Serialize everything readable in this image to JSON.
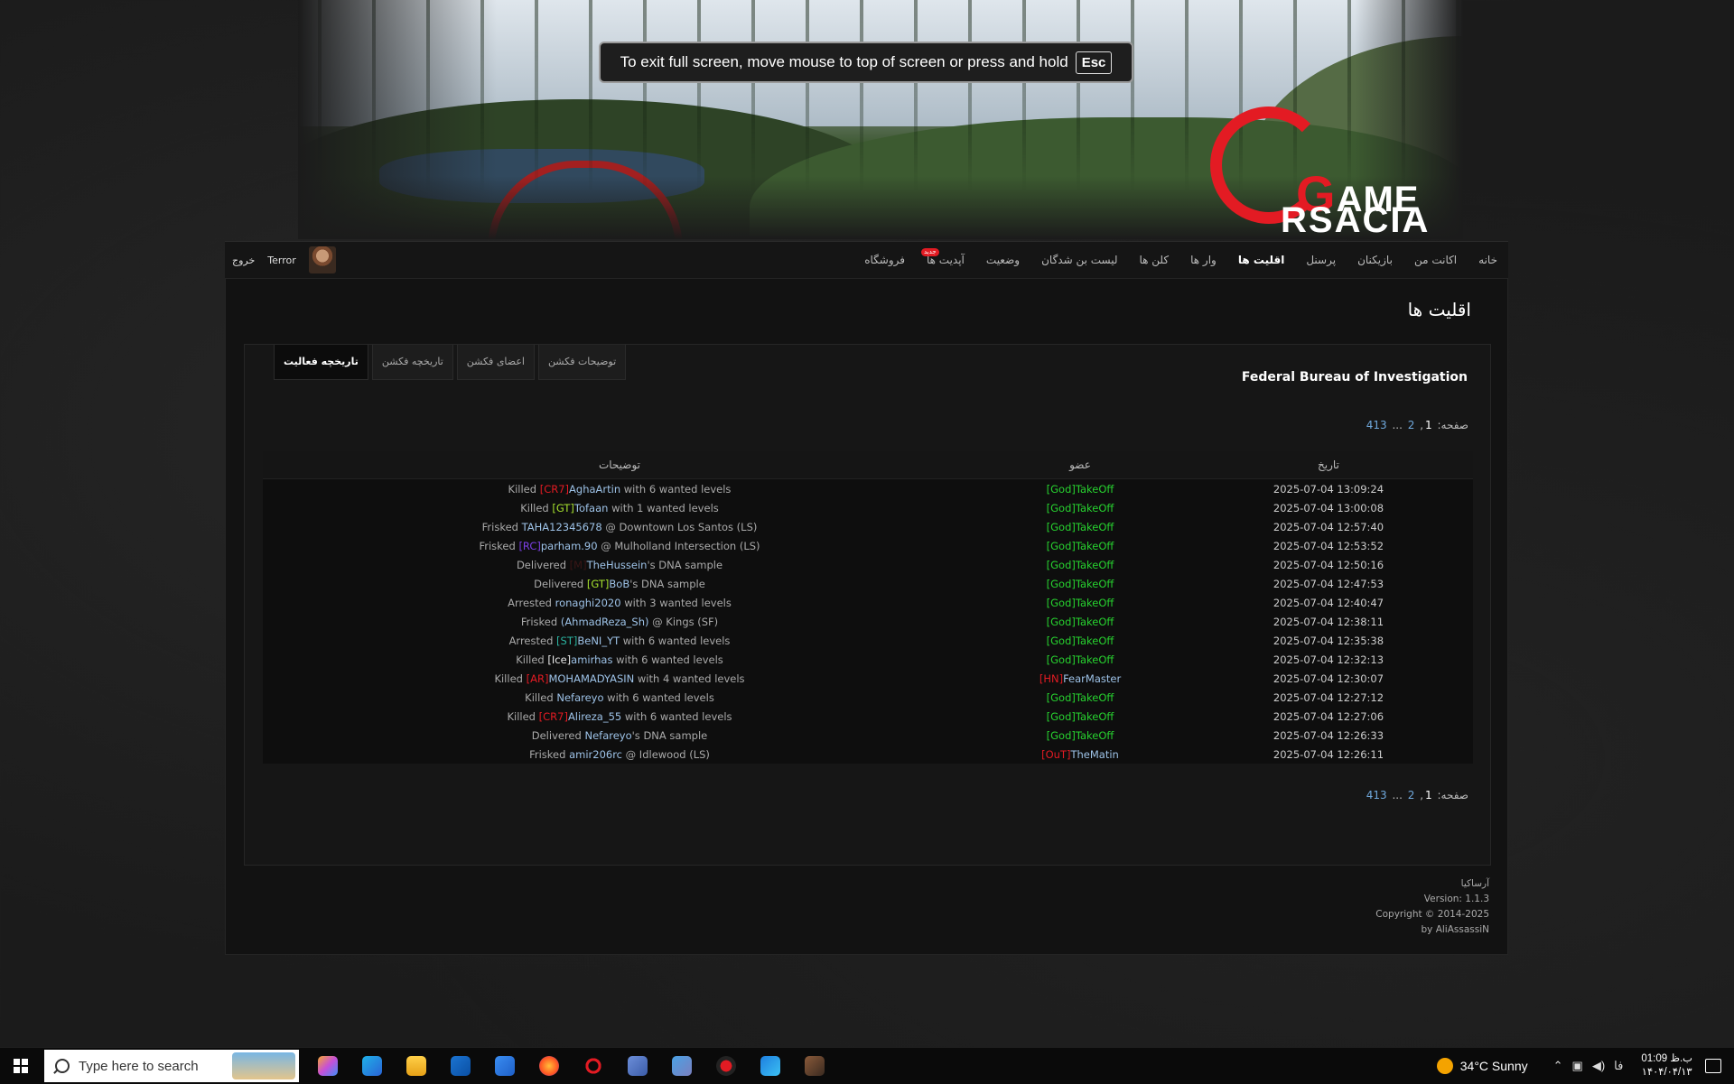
{
  "fullscreen_toast": {
    "text": "To exit full screen, move mouse to top of screen or press and hold",
    "key": "Esc"
  },
  "logo": {
    "line1": "AME",
    "line2": "RSACIA"
  },
  "nav": {
    "items": [
      {
        "label": "خانه",
        "active": false
      },
      {
        "label": "اکانت من",
        "active": false
      },
      {
        "label": "بازیکنان",
        "active": false
      },
      {
        "label": "پرسنل",
        "active": false
      },
      {
        "label": "اقلیت ها",
        "active": true
      },
      {
        "label": "وار ها",
        "active": false
      },
      {
        "label": "کلن ها",
        "active": false
      },
      {
        "label": "لیست بن شدگان",
        "active": false
      },
      {
        "label": "وضعیت",
        "active": false
      },
      {
        "label": "آپدیت ها",
        "active": false,
        "badge": "جدید"
      },
      {
        "label": "فروشگاه",
        "active": false
      }
    ],
    "username": "Terror",
    "logout": "خروج"
  },
  "page_title": "اقلیت ها",
  "faction": {
    "name": "Federal Bureau of Investigation",
    "tabs": [
      {
        "label": "توضیحات فکشن",
        "active": false
      },
      {
        "label": "اعضای فکشن",
        "active": false
      },
      {
        "label": "تاریخچه فکشن",
        "active": false
      },
      {
        "label": "تاریخچه فعالیت",
        "active": true
      }
    ]
  },
  "pager": {
    "label": "صفحه:",
    "pages": [
      "1",
      "2",
      "...",
      "413"
    ]
  },
  "table": {
    "headers": {
      "date": "تاریخ",
      "member": "عضو",
      "desc": "توضیحات"
    },
    "rows": [
      {
        "date": "2025-07-04 13:09:24",
        "member_tag": "[God]",
        "member_tag_color": "#27d22f",
        "member": "TakeOff",
        "member_color": "#27d22f",
        "action": "Killed",
        "tag": "[CR7]",
        "tag_color": "#e31b23",
        "target": "AghaArtin",
        "rest": "with 6 wanted levels"
      },
      {
        "date": "2025-07-04 13:00:08",
        "member_tag": "[God]",
        "member_tag_color": "#27d22f",
        "member": "TakeOff",
        "member_color": "#27d22f",
        "action": "Killed",
        "tag": "[GT]",
        "tag_color": "#a6e22e",
        "target": "Tofaan",
        "rest": "with 1 wanted levels"
      },
      {
        "date": "2025-07-04 12:57:40",
        "member_tag": "[God]",
        "member_tag_color": "#27d22f",
        "member": "TakeOff",
        "member_color": "#27d22f",
        "action": "Frisked",
        "tag": "",
        "tag_color": "#9ec3e8",
        "target": "TAHA12345678",
        "rest": "@ Downtown Los Santos (LS)"
      },
      {
        "date": "2025-07-04 12:53:52",
        "member_tag": "[God]",
        "member_tag_color": "#27d22f",
        "member": "TakeOff",
        "member_color": "#27d22f",
        "action": "Frisked",
        "tag": "[RC]",
        "tag_color": "#7b3fe4",
        "target": "parham.90",
        "rest": "@ Mulholland Intersection (LS)"
      },
      {
        "date": "2025-07-04 12:50:16",
        "member_tag": "[God]",
        "member_tag_color": "#27d22f",
        "member": "TakeOff",
        "member_color": "#27d22f",
        "action": "Delivered",
        "tag": "[M]",
        "tag_color": "#3a1616",
        "target": "TheHussein",
        "rest": "'s DNA sample"
      },
      {
        "date": "2025-07-04 12:47:53",
        "member_tag": "[God]",
        "member_tag_color": "#27d22f",
        "member": "TakeOff",
        "member_color": "#27d22f",
        "action": "Delivered",
        "tag": "[GT]",
        "tag_color": "#a6e22e",
        "target": "BoB",
        "rest": "'s DNA sample"
      },
      {
        "date": "2025-07-04 12:40:47",
        "member_tag": "[God]",
        "member_tag_color": "#27d22f",
        "member": "TakeOff",
        "member_color": "#27d22f",
        "action": "Arrested",
        "tag": "",
        "tag_color": "#9ec3e8",
        "target": "ronaghi2020",
        "rest": "with 3 wanted levels"
      },
      {
        "date": "2025-07-04 12:38:11",
        "member_tag": "[God]",
        "member_tag_color": "#27d22f",
        "member": "TakeOff",
        "member_color": "#27d22f",
        "action": "Frisked",
        "tag": "(",
        "tag_color": "#9ec3e8",
        "target": "AhmadReza_Sh)",
        "rest": "@ Kings (SF)"
      },
      {
        "date": "2025-07-04 12:35:38",
        "member_tag": "[God]",
        "member_tag_color": "#27d22f",
        "member": "TakeOff",
        "member_color": "#27d22f",
        "action": "Arrested",
        "tag": "[ST]",
        "tag_color": "#2bb3a0",
        "target": "BeNI_YT",
        "rest": "with 6 wanted levels"
      },
      {
        "date": "2025-07-04 12:32:13",
        "member_tag": "[God]",
        "member_tag_color": "#27d22f",
        "member": "TakeOff",
        "member_color": "#27d22f",
        "action": "Killed",
        "tag": "[Ice]",
        "tag_color": "#e8e8e8",
        "target": "amirhas",
        "rest": "with 6 wanted levels"
      },
      {
        "date": "2025-07-04 12:30:07",
        "member_tag": "[HN]",
        "member_tag_color": "#e31b23",
        "member": "FearMaster",
        "member_color": "#9ec3e8",
        "action": "Killed",
        "tag": "[AR]",
        "tag_color": "#e31b23",
        "target": "MOHAMADYASIN",
        "rest": "with 4 wanted levels"
      },
      {
        "date": "2025-07-04 12:27:12",
        "member_tag": "[God]",
        "member_tag_color": "#27d22f",
        "member": "TakeOff",
        "member_color": "#27d22f",
        "action": "Killed",
        "tag": "",
        "tag_color": "#9ec3e8",
        "target": "Nefareyo",
        "rest": "with 6 wanted levels"
      },
      {
        "date": "2025-07-04 12:27:06",
        "member_tag": "[God]",
        "member_tag_color": "#27d22f",
        "member": "TakeOff",
        "member_color": "#27d22f",
        "action": "Killed",
        "tag": "[CR7]",
        "tag_color": "#e31b23",
        "target": "Alireza_55",
        "rest": "with 6 wanted levels"
      },
      {
        "date": "2025-07-04 12:26:33",
        "member_tag": "[God]",
        "member_tag_color": "#27d22f",
        "member": "TakeOff",
        "member_color": "#27d22f",
        "action": "Delivered",
        "tag": "",
        "tag_color": "#9ec3e8",
        "target": "Nefareyo",
        "rest": "'s DNA sample"
      },
      {
        "date": "2025-07-04 12:26:11",
        "member_tag": "[OuT]",
        "member_tag_color": "#e31b23",
        "member": "TheMatin",
        "member_color": "#9ec3e8",
        "action": "Frisked",
        "tag": "",
        "tag_color": "#9ec3e8",
        "target": "amir206rc",
        "rest": "@ Idlewood (LS)"
      }
    ]
  },
  "footer": {
    "site": "آرساکیا",
    "version": "Version: 1.1.3",
    "copyright": "Copyright © 2014-2025",
    "by": "by AliAssassiN"
  },
  "taskbar": {
    "search_placeholder": "Type here to search",
    "apps": [
      "copilot-icon",
      "edge-icon",
      "file-explorer-icon",
      "outlook-icon",
      "store-icon",
      "firefox-icon",
      "arsacia-icon",
      "remote-desktop-icon",
      "control-panel-icon",
      "record-icon",
      "photos-icon",
      "game-icon"
    ],
    "weather": "34°C  Sunny",
    "lang": "فا",
    "time": "01:09 ب.ظ",
    "date": "۱۴۰۴/۰۴/۱۳"
  }
}
